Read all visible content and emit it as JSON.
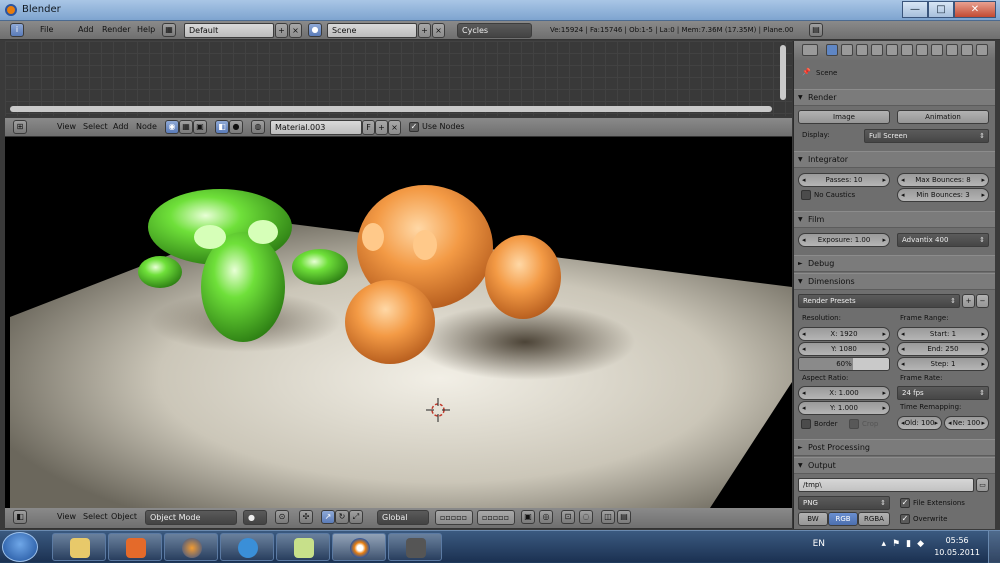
{
  "window": {
    "title": "Blender",
    "minimize": "—",
    "maximize": "□",
    "close": "✕"
  },
  "info_header": {
    "menus": [
      "File",
      "Add",
      "Render",
      "Help"
    ],
    "screen_layout": "Default",
    "scene": "Scene",
    "render_engine": "Cycles",
    "stats": "Ve:15924 | Fa:15746 | Ob:1-5 | La:0 | Mem:7.36M (17.35M) | Plane.001"
  },
  "node_header": {
    "menus": [
      "View",
      "Select",
      "Add",
      "Node"
    ],
    "material": "Material.003",
    "fake_user": "F",
    "use_nodes_label": "Use Nodes"
  },
  "view3d_header": {
    "menus": [
      "View",
      "Select",
      "Object"
    ],
    "mode": "Object Mode",
    "orientation": "Global"
  },
  "properties": {
    "breadcrumb": "Scene",
    "render": {
      "title": "Render",
      "image_button": "Image",
      "animation_button": "Animation",
      "display_label": "Display:",
      "display_value": "Full Screen"
    },
    "integrator": {
      "title": "Integrator",
      "passes": "Passes: 10",
      "max_bounces": "Max Bounces: 8",
      "min_bounces": "Min Bounces: 3",
      "no_caustics": "No Caustics"
    },
    "film": {
      "title": "Film",
      "exposure": "Exposure: 1.00",
      "response": "Advantix 400"
    },
    "debug": {
      "title": "Debug"
    },
    "dimensions": {
      "title": "Dimensions",
      "presets": "Render Presets",
      "resolution_label": "Resolution:",
      "res_x": "X: 1920",
      "res_y": "Y: 1080",
      "res_pct": "60%",
      "res_pct_value": 0.6,
      "frame_range_label": "Frame Range:",
      "start": "Start: 1",
      "end": "End: 250",
      "step": "Step: 1",
      "aspect_label": "Aspect Ratio:",
      "aspect_x": "X: 1.000",
      "aspect_y": "Y: 1.000",
      "frame_rate_label": "Frame Rate:",
      "frame_rate": "24 fps",
      "time_remap_label": "Time Remapping:",
      "old": "Old: 100",
      "new": "Ne: 100",
      "border": "Border",
      "crop": "Crop"
    },
    "post_processing": {
      "title": "Post Processing"
    },
    "output": {
      "title": "Output",
      "path": "/tmp\\",
      "format": "PNG",
      "file_extensions": "File Extensions",
      "bw": "BW",
      "rgb": "RGB",
      "rgba": "RGBA",
      "overwrite": "Overwrite"
    }
  },
  "taskbar": {
    "language": "EN",
    "time": "05:56",
    "date": "10.05.2011",
    "apps": [
      "explorer-icon",
      "media-player-icon",
      "firefox-icon",
      "ie-icon",
      "notes-icon",
      "blender-icon",
      "camera-icon"
    ]
  },
  "colors": {
    "accent": "#5f86c4",
    "blender_orange": "#e87d0d",
    "monkey_green": "#4fd82a",
    "monkey_orange": "#f2a25a"
  }
}
